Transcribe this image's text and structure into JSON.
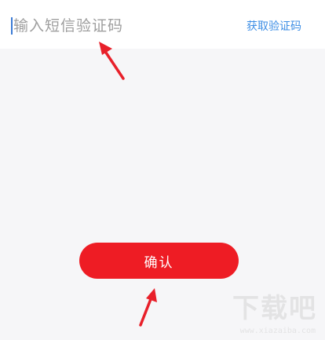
{
  "sms_form": {
    "code_input": {
      "placeholder": "输入短信验证码",
      "value": ""
    },
    "get_code_label": "获取验证码"
  },
  "confirm_label": "确认",
  "annotations": {
    "arrow_color": "#e8202a",
    "icons": [
      "annotation-arrow-icon",
      "annotation-arrow-icon"
    ]
  },
  "watermark": {
    "logo_text": "下载吧",
    "url": "www.xiazaiba.com"
  },
  "colors": {
    "accent_link": "#3d8ee5",
    "button_red": "#ee1c24",
    "background": "#f6f6f8"
  }
}
